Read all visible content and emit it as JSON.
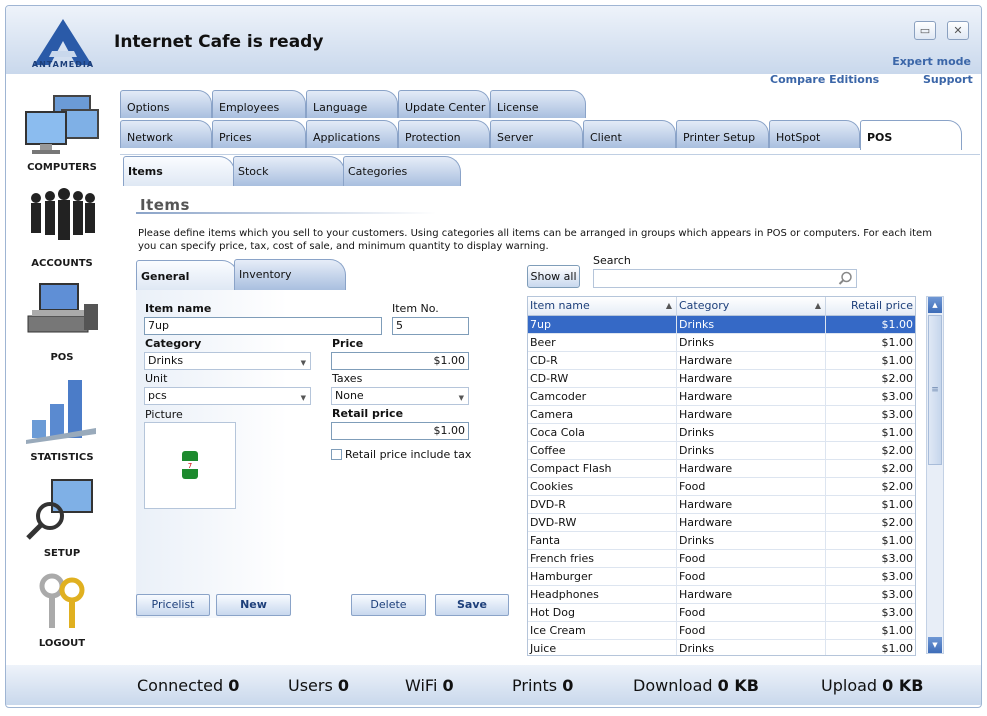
{
  "app": {
    "title": "Internet Cafe is ready",
    "logo_text": "ANTAMEDIA",
    "expert_mode": "Expert mode",
    "compare_editions": "Compare Editions",
    "support": "Support"
  },
  "sidebar": [
    {
      "label": "COMPUTERS",
      "icon": "computers-icon"
    },
    {
      "label": "ACCOUNTS",
      "icon": "accounts-icon"
    },
    {
      "label": "POS",
      "icon": "pos-icon"
    },
    {
      "label": "STATISTICS",
      "icon": "statistics-icon"
    },
    {
      "label": "SETUP",
      "icon": "setup-icon"
    },
    {
      "label": "LOGOUT",
      "icon": "logout-icon"
    }
  ],
  "tabs_row1": [
    "Options",
    "Employees",
    "Language",
    "Update Center",
    "License"
  ],
  "tabs_row2": [
    "Network",
    "Prices",
    "Applications",
    "Protection",
    "Server",
    "Client",
    "Printer Setup",
    "HotSpot",
    "POS"
  ],
  "subtabs": [
    "Items",
    "Stock",
    "Categories"
  ],
  "section": {
    "title": "Items",
    "description": "Please define items which you sell to your customers. Using categories all items can be arranged in groups which appears in POS or computers. For each item you can specify price, tax, cost of sale, and minimum quantity to display warning."
  },
  "form_tabs": [
    "General",
    "Inventory"
  ],
  "form": {
    "item_name_label": "Item name",
    "item_name": "7up",
    "item_no_label": "Item No.",
    "item_no": "5",
    "category_label": "Category",
    "category": "Drinks",
    "price_label": "Price",
    "price": "$1.00",
    "unit_label": "Unit",
    "unit": "pcs",
    "taxes_label": "Taxes",
    "taxes": "None",
    "picture_label": "Picture",
    "retail_price_label": "Retail price",
    "retail_price": "$1.00",
    "include_tax_label": "Retail price include tax"
  },
  "buttons": {
    "pricelist": "Pricelist",
    "new": "New",
    "delete": "Delete",
    "save": "Save",
    "show_all": "Show all"
  },
  "search": {
    "label": "Search"
  },
  "table": {
    "headers": [
      "Item name",
      "Category",
      "Retail price"
    ],
    "rows": [
      [
        "7up",
        "Drinks",
        "$1.00"
      ],
      [
        "Beer",
        "Drinks",
        "$1.00"
      ],
      [
        "CD-R",
        "Hardware",
        "$1.00"
      ],
      [
        "CD-RW",
        "Hardware",
        "$2.00"
      ],
      [
        "Camcoder",
        "Hardware",
        "$3.00"
      ],
      [
        "Camera",
        "Hardware",
        "$3.00"
      ],
      [
        "Coca Cola",
        "Drinks",
        "$1.00"
      ],
      [
        "Coffee",
        "Drinks",
        "$2.00"
      ],
      [
        "Compact Flash",
        "Hardware",
        "$2.00"
      ],
      [
        "Cookies",
        "Food",
        "$2.00"
      ],
      [
        "DVD-R",
        "Hardware",
        "$1.00"
      ],
      [
        "DVD-RW",
        "Hardware",
        "$2.00"
      ],
      [
        "Fanta",
        "Drinks",
        "$1.00"
      ],
      [
        "French fries",
        "Food",
        "$3.00"
      ],
      [
        "Hamburger",
        "Food",
        "$3.00"
      ],
      [
        "Headphones",
        "Hardware",
        "$3.00"
      ],
      [
        "Hot Dog",
        "Food",
        "$3.00"
      ],
      [
        "Ice Cream",
        "Food",
        "$1.00"
      ],
      [
        "Juice",
        "Drinks",
        "$1.00"
      ]
    ]
  },
  "status": [
    {
      "label": "Connected",
      "value": "0"
    },
    {
      "label": "Users",
      "value": "0"
    },
    {
      "label": "WiFi",
      "value": "0"
    },
    {
      "label": "Prints",
      "value": "0"
    },
    {
      "label": "Download",
      "value": "0 KB"
    },
    {
      "label": "Upload",
      "value": "0 KB"
    }
  ],
  "colors": {
    "accent": "#3b66a8",
    "selection": "#3569c6",
    "tab": "#a9bfdf"
  }
}
